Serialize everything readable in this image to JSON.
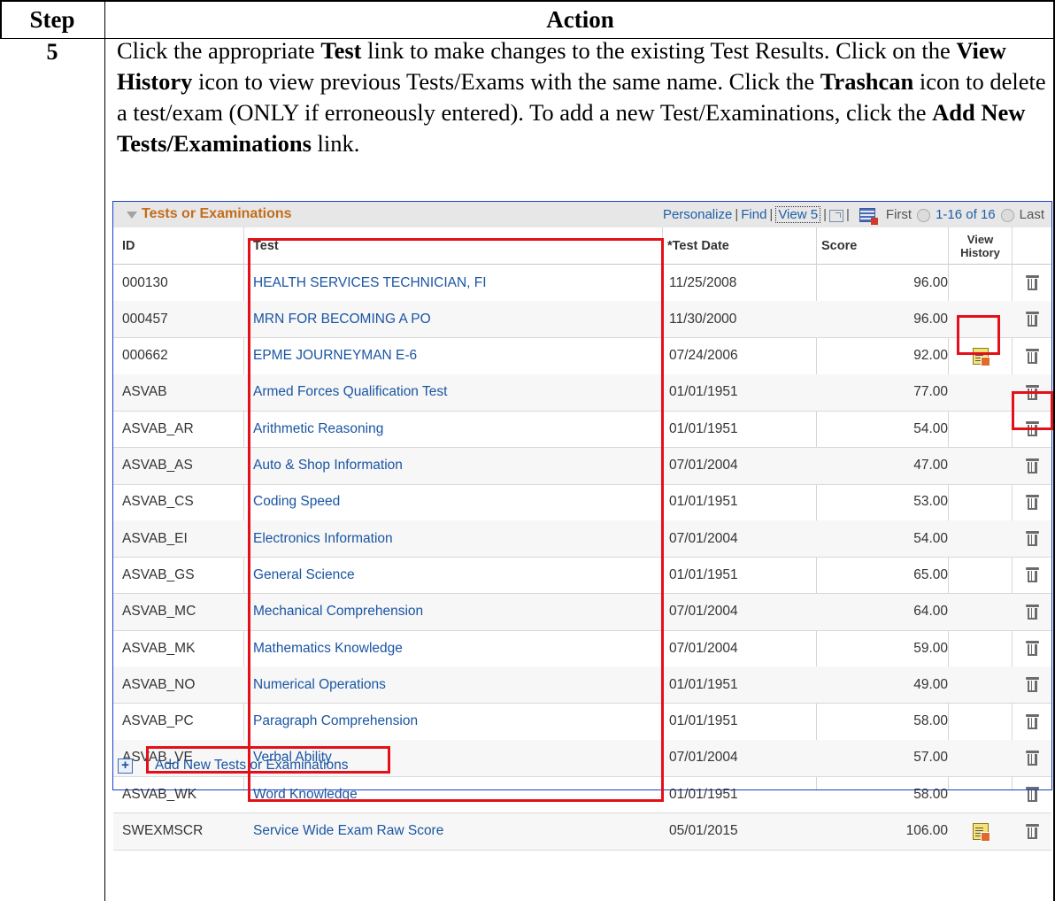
{
  "doc": {
    "step_header": "Step",
    "action_header": "Action",
    "step_number": "5",
    "instruction": {
      "t1": "Click the appropriate ",
      "b1": "Test",
      "t2": " link to make changes to the existing Test Results. Click on the ",
      "b2": "View History",
      "t3": " icon to view previous Tests/Exams with the same name. Click the ",
      "b3": "Trashcan",
      "t4": " icon to delete a test/exam (ONLY if erroneously entered). To add a new Test/Examinations, click the ",
      "b4": "Add New Tests/Examinations",
      "t5": " link."
    }
  },
  "grid": {
    "title": "Tests or Examinations",
    "nav": {
      "personalize": "Personalize",
      "find": "Find",
      "view": "View 5",
      "first": "First",
      "range": "1-16 of 16",
      "last": "Last"
    },
    "columns": {
      "id": "ID",
      "test": "Test",
      "date": "*Test Date",
      "score": "Score",
      "history_line1": "View",
      "history_line2": "History"
    },
    "rows": [
      {
        "id": "000130",
        "test": "HEALTH SERVICES TECHNICIAN, FI",
        "date": "11/25/2008",
        "score": "96.00",
        "history": false
      },
      {
        "id": "000457",
        "test": "MRN FOR BECOMING A PO",
        "date": "11/30/2000",
        "score": "96.00",
        "history": false
      },
      {
        "id": "000662",
        "test": "EPME JOURNEYMAN E-6",
        "date": "07/24/2006",
        "score": "92.00",
        "history": true
      },
      {
        "id": "ASVAB",
        "test": "Armed Forces Qualification Test",
        "date": "01/01/1951",
        "score": "77.00",
        "history": false
      },
      {
        "id": "ASVAB_AR",
        "test": "Arithmetic Reasoning",
        "date": "01/01/1951",
        "score": "54.00",
        "history": false
      },
      {
        "id": "ASVAB_AS",
        "test": "Auto & Shop Information",
        "date": "07/01/2004",
        "score": "47.00",
        "history": false
      },
      {
        "id": "ASVAB_CS",
        "test": "Coding Speed",
        "date": "01/01/1951",
        "score": "53.00",
        "history": false
      },
      {
        "id": "ASVAB_EI",
        "test": "Electronics Information",
        "date": "07/01/2004",
        "score": "54.00",
        "history": false
      },
      {
        "id": "ASVAB_GS",
        "test": "General Science",
        "date": "01/01/1951",
        "score": "65.00",
        "history": false
      },
      {
        "id": "ASVAB_MC",
        "test": "Mechanical Comprehension",
        "date": "07/01/2004",
        "score": "64.00",
        "history": false
      },
      {
        "id": "ASVAB_MK",
        "test": "Mathematics Knowledge",
        "date": "07/01/2004",
        "score": "59.00",
        "history": false
      },
      {
        "id": "ASVAB_NO",
        "test": "Numerical Operations",
        "date": "01/01/1951",
        "score": "49.00",
        "history": false
      },
      {
        "id": "ASVAB_PC",
        "test": "Paragraph Comprehension",
        "date": "01/01/1951",
        "score": "58.00",
        "history": false
      },
      {
        "id": "ASVAB_VE",
        "test": "Verbal Ability",
        "date": "07/01/2004",
        "score": "57.00",
        "history": false
      },
      {
        "id": "ASVAB_WK",
        "test": "Word Knowledge",
        "date": "01/01/1951",
        "score": "58.00",
        "history": false
      },
      {
        "id": "SWEXMSCR",
        "test": "Service Wide Exam Raw Score",
        "date": "05/01/2015",
        "score": "106.00",
        "history": true
      }
    ],
    "add_link": "Add New Tests or Examinations"
  },
  "colors": {
    "link": "#1a55a3",
    "title": "#c26d1a",
    "highlight": "#e3101a",
    "grid_border": "#1b40c8"
  }
}
